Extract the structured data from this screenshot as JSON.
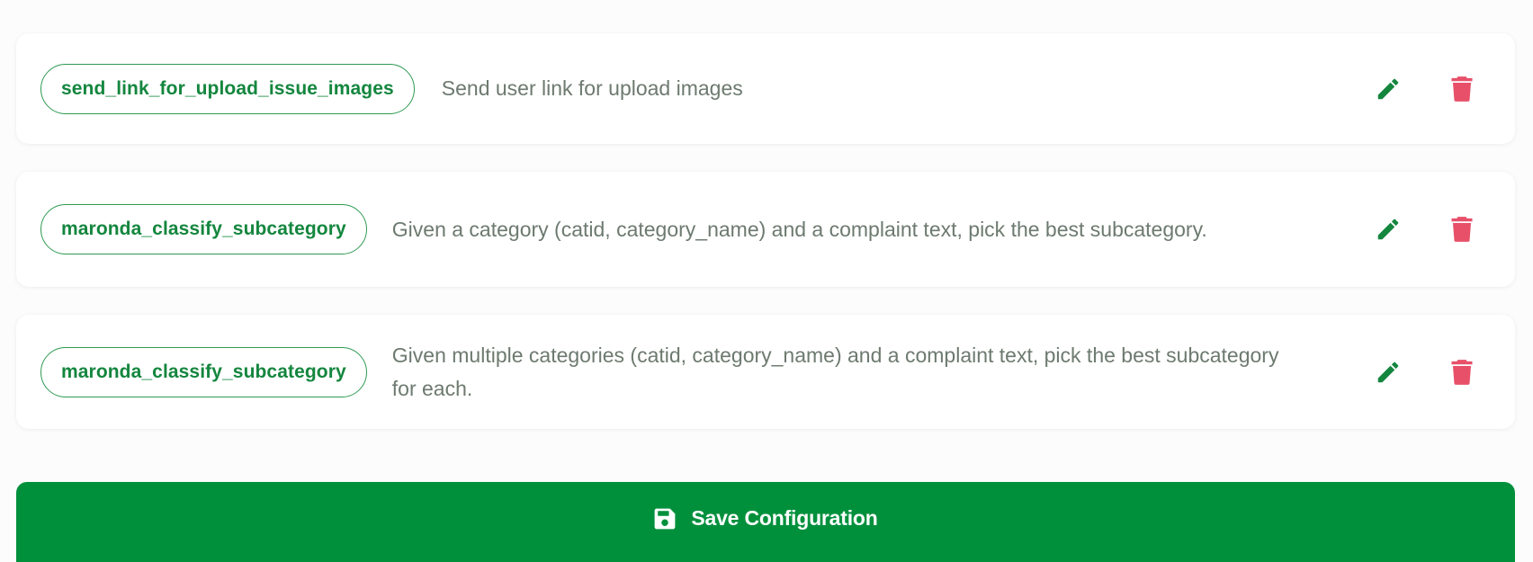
{
  "tools": [
    {
      "name": "send_link_for_upload_issue_images",
      "description": "Send user link for upload images"
    },
    {
      "name": "maronda_classify_subcategory",
      "description": "Given a category (catid, category_name) and a complaint text, pick the best subcategory."
    },
    {
      "name": "maronda_classify_subcategory",
      "description": "Given multiple categories (catid, category_name) and a complaint text, pick the best subcategory for each."
    }
  ],
  "actions": {
    "edit_icon": "pencil-icon",
    "delete_icon": "trash-icon"
  },
  "save_button": {
    "label": "Save Configuration",
    "icon": "floppy-disk-icon"
  },
  "colors": {
    "accent_green": "#00903c",
    "tag_green": "#14863e",
    "delete_red": "#e8506a",
    "description_gray": "#6d7a6f"
  }
}
